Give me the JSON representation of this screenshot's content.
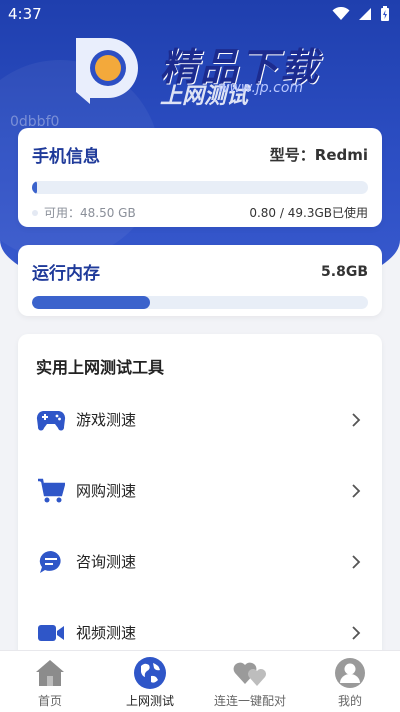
{
  "status": {
    "time": "4:37"
  },
  "logo": {
    "main_text": "精品下载",
    "sub_text": "上网测试",
    "url_text": "www.jp.com"
  },
  "watermark": "0dbbf0",
  "phone_card": {
    "title": "手机信息",
    "model": "型号：Redmi",
    "storage_used_fraction": 0.016,
    "available": "可用：48.50 GB",
    "used": "0.80 / 49.3GB已使用"
  },
  "ram_card": {
    "title": "运行内存",
    "value": "5.8GB",
    "used_fraction": 0.35
  },
  "tools": {
    "title": "实用上网测试工具",
    "items": [
      {
        "label": "游戏测速",
        "icon": "gamepad-icon"
      },
      {
        "label": "网购测速",
        "icon": "shopping-cart-icon"
      },
      {
        "label": "咨询测速",
        "icon": "chat-bubble-icon"
      },
      {
        "label": "视频测速",
        "icon": "video-camera-icon"
      }
    ]
  },
  "tabbar": {
    "items": [
      {
        "label": "首页",
        "icon": "home-icon",
        "active": false
      },
      {
        "label": "上网测试",
        "icon": "globe-icon",
        "active": true
      },
      {
        "label": "连连一键配对",
        "icon": "hearts-icon",
        "active": false
      },
      {
        "label": "我的",
        "icon": "profile-icon",
        "active": false
      }
    ]
  },
  "colors": {
    "accent": "#3b63cc",
    "header": "#2d4fc4",
    "title": "#1f3a9a"
  }
}
